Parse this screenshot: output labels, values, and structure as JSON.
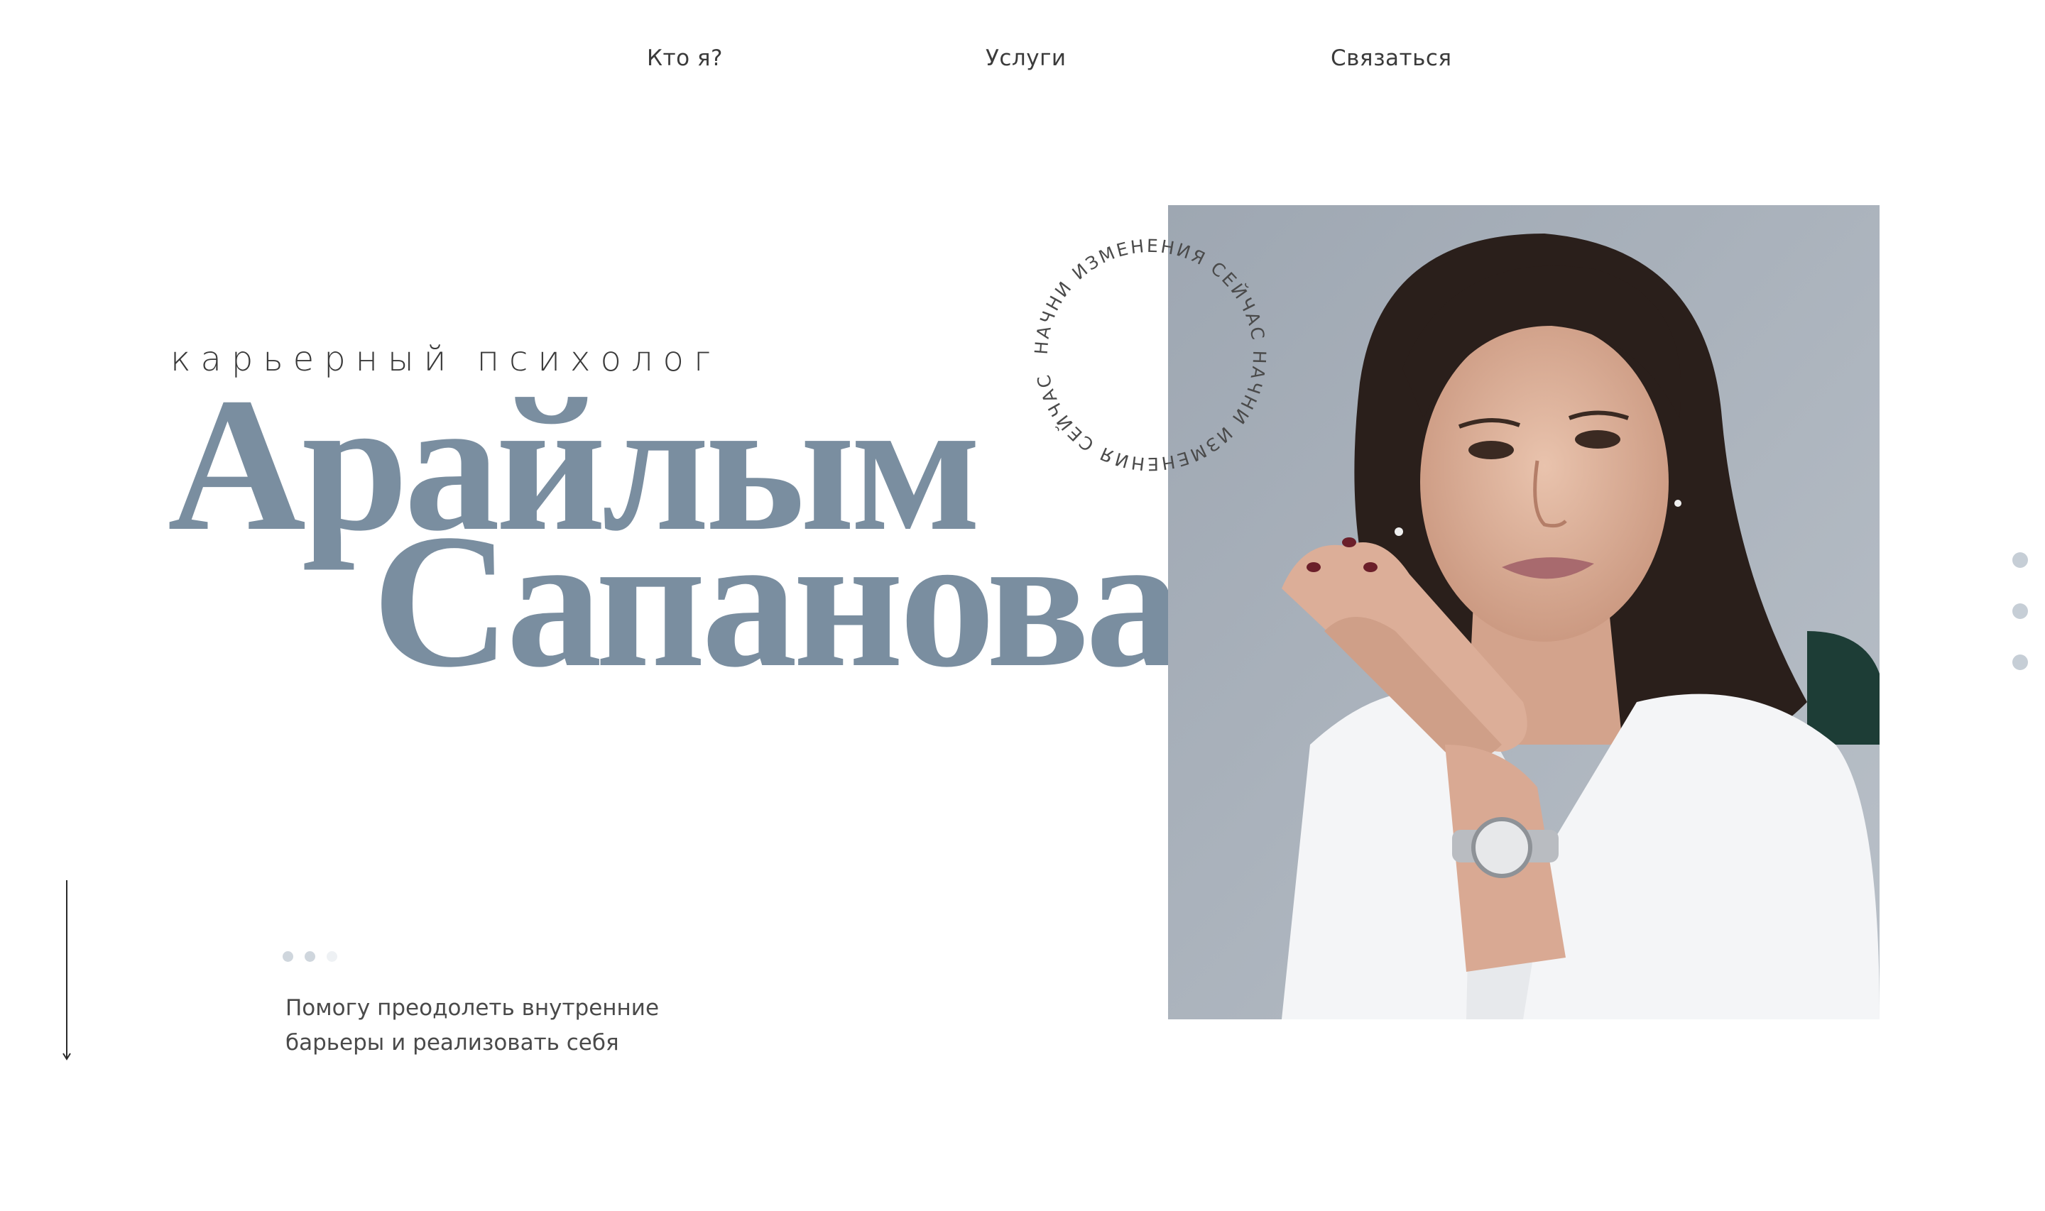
{
  "nav": {
    "about": "Кто я?",
    "services": "Услуги",
    "contact": "Связаться"
  },
  "hero": {
    "subtitle": "карьерный психолог",
    "first_name": "Арайлым",
    "last_name": "Сапанова",
    "tagline": "Помогу преодолеть внутренние барьеры и реализовать себя"
  },
  "badge": {
    "circular_text": "НАЧНИ ИЗМЕНЕНИЯ СЕЙЧАС НАЧНИ ИЗМЕНЕНИЯ СЕЙЧАС "
  },
  "colors": {
    "accent": "#7a8ea0",
    "text": "#3f3f3f",
    "dot_active": "#c6ced6",
    "dot_faint": "#e8ecf0"
  },
  "icons": {
    "scroll": "arrow-down-icon",
    "pager": "dot-icon"
  }
}
